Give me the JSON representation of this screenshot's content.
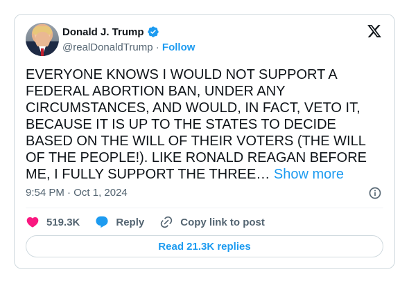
{
  "author": {
    "name": "Donald J. Trump",
    "handle": "@realDonaldTrump",
    "separator": "·",
    "follow_label": "Follow"
  },
  "tweet": {
    "text": "EVERYONE KNOWS I WOULD NOT SUPPORT A FEDERAL ABORTION BAN, UNDER ANY CIRCUMSTANCES, AND WOULD, IN FACT, VETO IT, BECAUSE IT IS UP TO THE STATES TO DECIDE BASED ON THE WILL OF THEIR VOTERS (THE WILL OF THE PEOPLE!). LIKE RONALD REAGAN BEFORE ME, I FULLY SUPPORT THE THREE…",
    "show_more_label": "Show more",
    "time": "9:54 PM",
    "separator": "·",
    "date": "Oct 1, 2024"
  },
  "actions": {
    "likes": "519.3K",
    "reply_label": "Reply",
    "copy_link_label": "Copy link to post"
  },
  "read_replies_label": "Read 21.3K replies",
  "colors": {
    "accent": "#1d9bf0",
    "like": "#f91880",
    "secondary_text": "#536471",
    "border": "#cfd9de"
  },
  "icons": {
    "verified": "verified-badge-icon",
    "platform": "x-logo-icon",
    "info": "info-icon",
    "like": "heart-icon",
    "reply": "speech-bubble-icon",
    "copy_link": "link-icon"
  }
}
